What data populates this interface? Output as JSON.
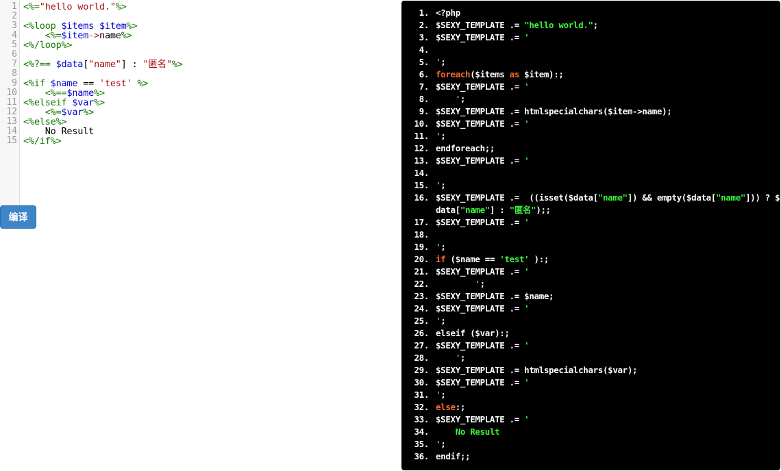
{
  "editor": {
    "line_numbers": [
      "1",
      "2",
      "3",
      "4",
      "5",
      "6",
      "7",
      "8",
      "9",
      "10",
      "11",
      "12",
      "13",
      "14",
      "15"
    ],
    "lines": [
      [
        {
          "t": "<%=",
          "c": "tag"
        },
        {
          "t": "\"hello world.\"",
          "c": "str"
        },
        {
          "t": "%>",
          "c": "tag"
        }
      ],
      [],
      [
        {
          "t": "<%loop ",
          "c": "tag"
        },
        {
          "t": "$items",
          "c": "var"
        },
        {
          "t": " ",
          "c": "plain"
        },
        {
          "t": "$item",
          "c": "var"
        },
        {
          "t": "%>",
          "c": "tag"
        }
      ],
      [
        {
          "t": "    ",
          "c": "plain"
        },
        {
          "t": "<%=",
          "c": "tag"
        },
        {
          "t": "$item",
          "c": "var"
        },
        {
          "t": "->",
          "c": "op"
        },
        {
          "t": "name",
          "c": "plain"
        },
        {
          "t": "%>",
          "c": "tag"
        }
      ],
      [
        {
          "t": "<%/loop%>",
          "c": "tag"
        }
      ],
      [],
      [
        {
          "t": "<%?==",
          "c": "tag"
        },
        {
          "t": " ",
          "c": "plain"
        },
        {
          "t": "$data",
          "c": "var"
        },
        {
          "t": "[",
          "c": "plain"
        },
        {
          "t": "\"name\"",
          "c": "str"
        },
        {
          "t": "] : ",
          "c": "plain"
        },
        {
          "t": "\"匿名\"",
          "c": "str"
        },
        {
          "t": "%>",
          "c": "tag"
        }
      ],
      [],
      [
        {
          "t": "<%if ",
          "c": "tag"
        },
        {
          "t": "$name",
          "c": "var"
        },
        {
          "t": " == ",
          "c": "plain"
        },
        {
          "t": "'test'",
          "c": "str"
        },
        {
          "t": " %>",
          "c": "tag"
        }
      ],
      [
        {
          "t": "    ",
          "c": "plain"
        },
        {
          "t": "<%==",
          "c": "tag"
        },
        {
          "t": "$name",
          "c": "var"
        },
        {
          "t": "%>",
          "c": "tag"
        }
      ],
      [
        {
          "t": "<%elseif ",
          "c": "tag"
        },
        {
          "t": "$var",
          "c": "var"
        },
        {
          "t": "%>",
          "c": "tag"
        }
      ],
      [
        {
          "t": "    ",
          "c": "plain"
        },
        {
          "t": "<%=",
          "c": "tag"
        },
        {
          "t": "$var",
          "c": "var"
        },
        {
          "t": "%>",
          "c": "tag"
        }
      ],
      [
        {
          "t": "<%else%>",
          "c": "tag"
        }
      ],
      [
        {
          "t": "    No Result",
          "c": "plain"
        }
      ],
      [
        {
          "t": "<%/if%>",
          "c": "tag"
        }
      ]
    ]
  },
  "compile_button": {
    "label": "编译"
  },
  "output": {
    "lines": [
      {
        "num": "1.",
        "segs": [
          {
            "t": "<?php",
            "c": ""
          }
        ]
      },
      {
        "num": "2.",
        "segs": [
          {
            "t": "$SEXY_TEMPLATE .= ",
            "c": ""
          },
          {
            "t": "\"hello world.\"",
            "c": "str"
          },
          {
            "t": ";",
            "c": ""
          }
        ]
      },
      {
        "num": "3.",
        "segs": [
          {
            "t": "$SEXY_TEMPLATE .= ",
            "c": ""
          },
          {
            "t": "'",
            "c": "str"
          }
        ]
      },
      {
        "num": "4.",
        "segs": []
      },
      {
        "num": "5.",
        "segs": [
          {
            "t": "'",
            "c": "str"
          },
          {
            "t": ";",
            "c": ""
          }
        ]
      },
      {
        "num": "6.",
        "segs": [
          {
            "t": "foreach",
            "c": "kw"
          },
          {
            "t": "($items ",
            "c": ""
          },
          {
            "t": "as",
            "c": "kw"
          },
          {
            "t": " $item):;",
            "c": ""
          }
        ]
      },
      {
        "num": "7.",
        "segs": [
          {
            "t": "$SEXY_TEMPLATE .= ",
            "c": ""
          },
          {
            "t": "'",
            "c": "str"
          }
        ]
      },
      {
        "num": "8.",
        "segs": [
          {
            "t": "    '",
            "c": "str"
          },
          {
            "t": ";",
            "c": ""
          }
        ]
      },
      {
        "num": "9.",
        "segs": [
          {
            "t": "$SEXY_TEMPLATE .= htmlspecialchars($item->name);",
            "c": ""
          }
        ]
      },
      {
        "num": "10.",
        "segs": [
          {
            "t": "$SEXY_TEMPLATE .= ",
            "c": ""
          },
          {
            "t": "'",
            "c": "str"
          }
        ]
      },
      {
        "num": "11.",
        "segs": [
          {
            "t": "'",
            "c": "str"
          },
          {
            "t": ";",
            "c": ""
          }
        ]
      },
      {
        "num": "12.",
        "segs": [
          {
            "t": "endforeach;;",
            "c": ""
          }
        ]
      },
      {
        "num": "13.",
        "segs": [
          {
            "t": "$SEXY_TEMPLATE .= ",
            "c": ""
          },
          {
            "t": "'",
            "c": "str"
          }
        ]
      },
      {
        "num": "14.",
        "segs": []
      },
      {
        "num": "15.",
        "segs": [
          {
            "t": "'",
            "c": "str"
          },
          {
            "t": ";",
            "c": ""
          }
        ]
      },
      {
        "num": "16.",
        "segs": [
          {
            "t": "$SEXY_TEMPLATE .=  ((isset($data[",
            "c": ""
          },
          {
            "t": "\"name\"",
            "c": "str"
          },
          {
            "t": "]) && empty($data[",
            "c": ""
          },
          {
            "t": "\"name\"",
            "c": "str"
          },
          {
            "t": "])) ? $",
            "c": ""
          }
        ]
      },
      {
        "num": "",
        "segs": [
          {
            "t": "data[",
            "c": ""
          },
          {
            "t": "\"name\"",
            "c": "str"
          },
          {
            "t": "] : ",
            "c": ""
          },
          {
            "t": "\"匿名\"",
            "c": "str"
          },
          {
            "t": ");;",
            "c": ""
          }
        ]
      },
      {
        "num": "17.",
        "segs": [
          {
            "t": "$SEXY_TEMPLATE .= ",
            "c": ""
          },
          {
            "t": "'",
            "c": "str"
          }
        ]
      },
      {
        "num": "18.",
        "segs": []
      },
      {
        "num": "19.",
        "segs": [
          {
            "t": "'",
            "c": "str"
          },
          {
            "t": ";",
            "c": ""
          }
        ]
      },
      {
        "num": "20.",
        "segs": [
          {
            "t": "if",
            "c": "kw"
          },
          {
            "t": " ($name == ",
            "c": ""
          },
          {
            "t": "'test'",
            "c": "str"
          },
          {
            "t": " ):;",
            "c": ""
          }
        ]
      },
      {
        "num": "21.",
        "segs": [
          {
            "t": "$SEXY_TEMPLATE .= ",
            "c": ""
          },
          {
            "t": "'",
            "c": "str"
          }
        ]
      },
      {
        "num": "22.",
        "segs": [
          {
            "t": "        '",
            "c": "str"
          },
          {
            "t": ";",
            "c": ""
          }
        ]
      },
      {
        "num": "23.",
        "segs": [
          {
            "t": "$SEXY_TEMPLATE .= $name;",
            "c": ""
          }
        ]
      },
      {
        "num": "24.",
        "segs": [
          {
            "t": "$SEXY_TEMPLATE .= ",
            "c": ""
          },
          {
            "t": "'",
            "c": "str"
          }
        ]
      },
      {
        "num": "25.",
        "segs": [
          {
            "t": "'",
            "c": "str"
          },
          {
            "t": ";",
            "c": ""
          }
        ]
      },
      {
        "num": "26.",
        "segs": [
          {
            "t": "elseif ($var):;",
            "c": ""
          }
        ]
      },
      {
        "num": "27.",
        "segs": [
          {
            "t": "$SEXY_TEMPLATE .= ",
            "c": ""
          },
          {
            "t": "'",
            "c": "str"
          }
        ]
      },
      {
        "num": "28.",
        "segs": [
          {
            "t": "    '",
            "c": "str"
          },
          {
            "t": ";",
            "c": ""
          }
        ]
      },
      {
        "num": "29.",
        "segs": [
          {
            "t": "$SEXY_TEMPLATE .= htmlspecialchars($var);",
            "c": ""
          }
        ]
      },
      {
        "num": "30.",
        "segs": [
          {
            "t": "$SEXY_TEMPLATE .= ",
            "c": ""
          },
          {
            "t": "'",
            "c": "str"
          }
        ]
      },
      {
        "num": "31.",
        "segs": [
          {
            "t": "'",
            "c": "str"
          },
          {
            "t": ";",
            "c": ""
          }
        ]
      },
      {
        "num": "32.",
        "segs": [
          {
            "t": "else",
            "c": "kw"
          },
          {
            "t": ":;",
            "c": ""
          }
        ]
      },
      {
        "num": "33.",
        "segs": [
          {
            "t": "$SEXY_TEMPLATE .= ",
            "c": ""
          },
          {
            "t": "'",
            "c": "str"
          }
        ]
      },
      {
        "num": "34.",
        "segs": [
          {
            "t": "    No Result",
            "c": "str"
          }
        ]
      },
      {
        "num": "35.",
        "segs": [
          {
            "t": "'",
            "c": "str"
          },
          {
            "t": ";",
            "c": ""
          }
        ]
      },
      {
        "num": "36.",
        "segs": [
          {
            "t": "endif;;",
            "c": ""
          }
        ]
      }
    ]
  },
  "colors": {
    "template_tag": "#117700",
    "string": "#aa1111",
    "variable": "#0000cc",
    "output_keyword": "#ff6a2a",
    "output_string": "#3df23d",
    "button_bg": "#3d86c8"
  }
}
